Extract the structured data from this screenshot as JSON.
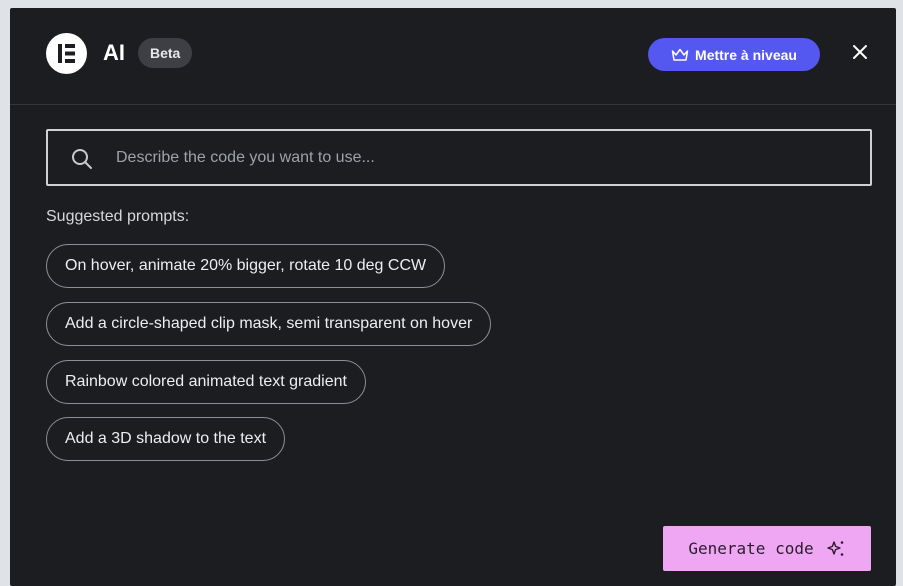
{
  "header": {
    "title": "AI",
    "badge": "Beta",
    "upgrade_label": "Mettre à niveau"
  },
  "search": {
    "placeholder": "Describe the code you want to use...",
    "value": ""
  },
  "suggestions": {
    "label": "Suggested prompts:",
    "items": [
      "On hover, animate 20% bigger, rotate 10 deg CCW",
      "Add a circle-shaped clip mask, semi transparent on hover",
      "Rainbow colored animated text gradient",
      "Add a 3D shadow to the text"
    ]
  },
  "actions": {
    "generate_label": "Generate code"
  },
  "colors": {
    "dialog_background": "#1c1d21",
    "accent_upgrade": "#5457f0",
    "accent_generate": "#f0a7f3"
  },
  "icons": {
    "logo": "elementor-logo-icon",
    "upgrade": "crown-icon",
    "close": "close-icon",
    "search": "search-icon",
    "generate": "sparkle-icon"
  }
}
